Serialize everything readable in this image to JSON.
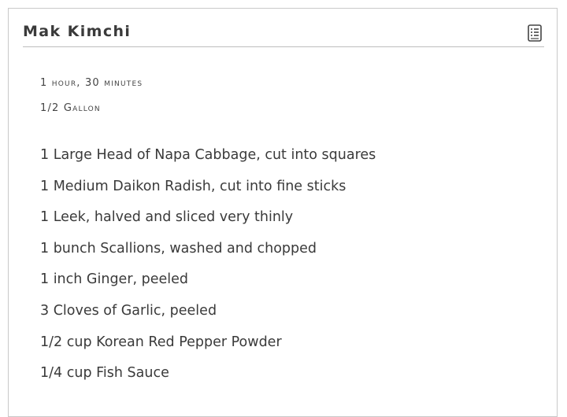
{
  "recipe": {
    "title": "Mak Kimchi",
    "time": "1 hour, 30 minutes",
    "yield": "1/2 Gallon",
    "print_icon": "print-recipe-icon",
    "ingredients": [
      "1 Large Head of Napa Cabbage, cut into squares",
      "1 Medium Daikon Radish, cut into fine sticks",
      "1 Leek, halved and sliced very thinly",
      "1 bunch Scallions, washed and chopped",
      "1 inch Ginger, peeled",
      "3 Cloves of Garlic, peeled",
      "1/2 cup Korean Red Pepper Powder",
      "1/4 cup Fish Sauce"
    ]
  }
}
